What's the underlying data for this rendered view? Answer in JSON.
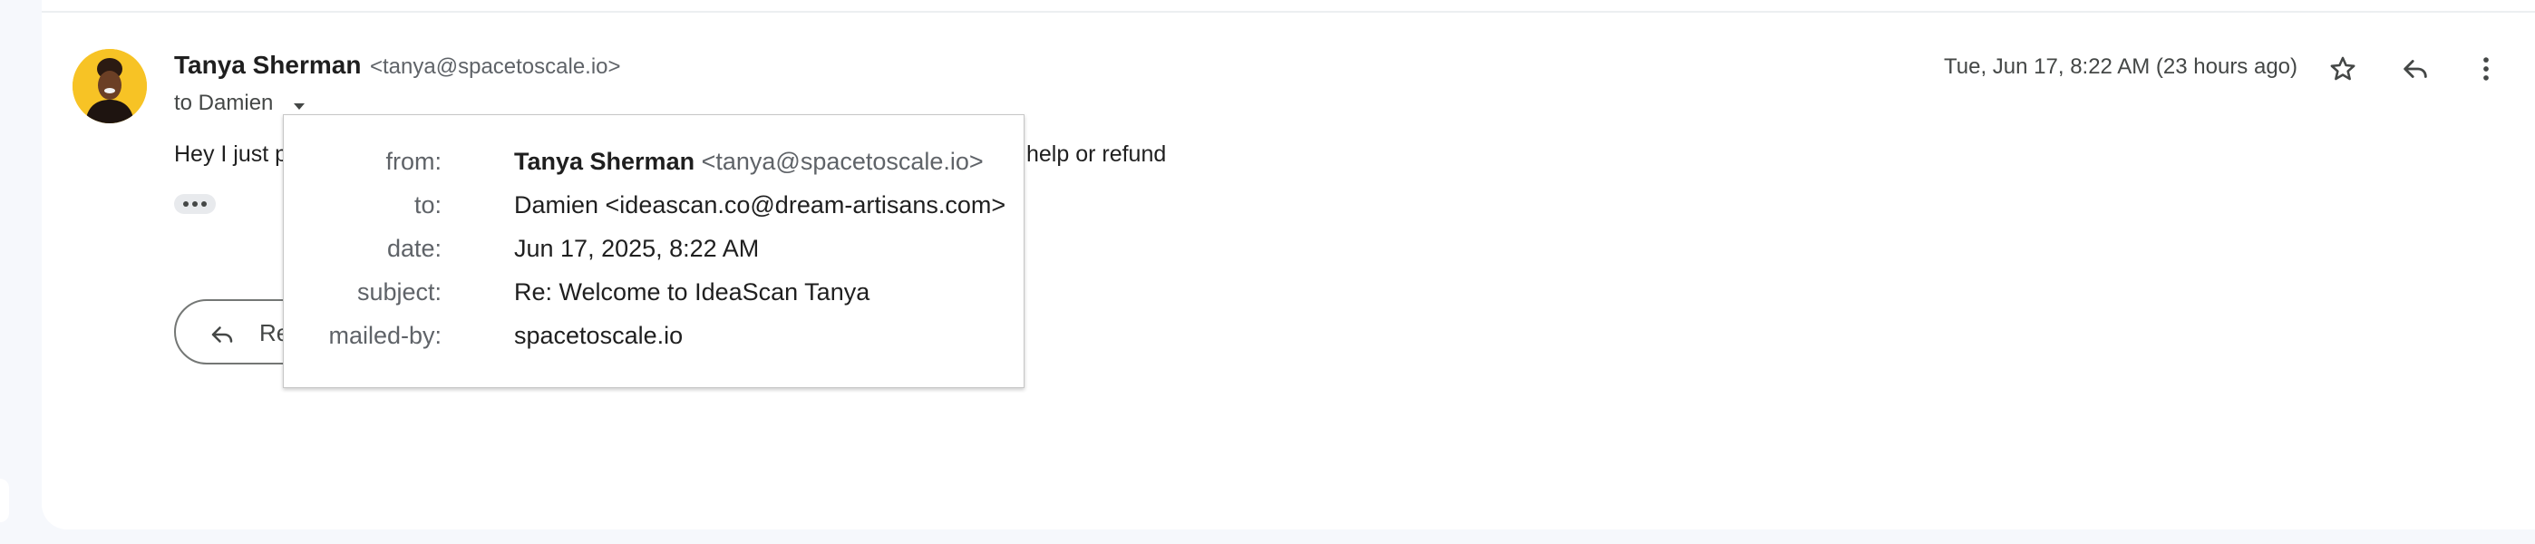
{
  "message": {
    "sender_name": "Tanya Sherman",
    "sender_email": "<tanya@spacetoscale.io>",
    "to_line": "to Damien",
    "date": "Tue, Jun 17, 8:22 AM (23 hours ago)",
    "body_start": "Hey I just p",
    "body_end": "help or refund",
    "reply_label": "Re"
  },
  "details_popup": {
    "from_label": "from:",
    "from_name": "Tanya Sherman",
    "from_email": "<tanya@spacetoscale.io>",
    "to_label": "to:",
    "to_value": "Damien <ideascan.co@dream-artisans.com>",
    "date_label": "date:",
    "date_value": "Jun 17, 2025, 8:22 AM",
    "subject_label": "subject:",
    "subject_value": "Re: Welcome to IdeaScan Tanya",
    "mailed_by_label": "mailed-by:",
    "mailed_by_value": "spacetoscale.io"
  },
  "icons": {
    "star": "star-icon",
    "reply": "reply-icon",
    "more": "more-vert-icon",
    "caret": "chevron-down-icon"
  },
  "colors": {
    "avatar_bg": "#f7c325",
    "page_bg": "#f6f8fc"
  }
}
